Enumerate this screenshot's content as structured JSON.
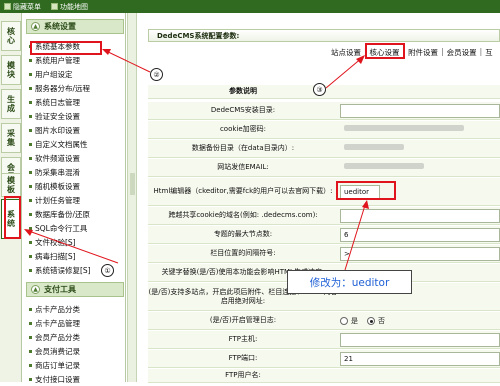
{
  "topbar": {
    "hide_menu": "隐藏菜单",
    "function_map": "功能地图"
  },
  "leftnav": {
    "tabs": [
      "核心",
      "模块",
      "生成",
      "采集",
      "会员",
      "模板",
      "系统"
    ]
  },
  "menu": {
    "section1": "系统设置",
    "items1": [
      "系统基本参数",
      "系统用户管理",
      "用户组设定",
      "服务器分布/远程",
      "系统日志管理",
      "验证安全设置",
      "图片水印设置",
      "自定义文档属性",
      "软件频道设置",
      "防采集串混淆",
      "随机模板设置",
      "计划任务管理",
      "数据库备份/还原",
      "SQL命令行工具",
      "文件校验[S]",
      "病毒扫描[S]",
      "系统错误修复[S]"
    ],
    "section2": "支付工具",
    "items2": [
      "点卡产品分类",
      "点卡产品管理",
      "会员产品分类",
      "会员消费记录",
      "商店订单记录",
      "支付接口设置"
    ]
  },
  "main": {
    "title": "DedeCMS系统配置参数:",
    "tabs": [
      "站点设置",
      "核心设置",
      "附件设置",
      "会员设置",
      "互"
    ],
    "table_header": "参数说明",
    "rows": [
      {
        "label": "DedeCMS安装目录:",
        "value": ""
      },
      {
        "label": "cookie加密码:",
        "value": ""
      },
      {
        "label": "数据备份目录（在data目录内）:",
        "value": ""
      },
      {
        "label": "网站发信EMAIL:",
        "value": ""
      },
      {
        "label": "Html编辑器（ckeditor,需要fck的用户可以去官网下载）:",
        "value": "ueditor"
      },
      {
        "label": "跨越共享cookie的域名(例如: .dedecms.com):",
        "value": ""
      },
      {
        "label": "专题的最大节点数:",
        "value": "6"
      },
      {
        "label": "栏目位置的间隔符号:",
        "value": ">"
      },
      {
        "label": "关键字替换(是/否)使用本功能会影响HTML生成速度:",
        "value": ""
      },
      {
        "label": "(是/否)支持多站点，开启此项后附件、栏目连接、arcurl内容启用绝对网址:",
        "value": ""
      },
      {
        "label": "(是/否)开启管理日志:",
        "value": ""
      },
      {
        "label": "FTP主机:",
        "value": ""
      },
      {
        "label": "FTP端口:",
        "value": "21"
      },
      {
        "label": "FTP用户名:",
        "value": ""
      }
    ],
    "radio_yes": "是",
    "radio_no": "否"
  },
  "annotation": {
    "text": "修改为：ueditor",
    "markers": [
      "①",
      "②",
      "③"
    ]
  },
  "colors": {
    "brand_green": "#2f6a20",
    "highlight_red": "#e0141c",
    "annotation_blue": "#1f60d6"
  }
}
